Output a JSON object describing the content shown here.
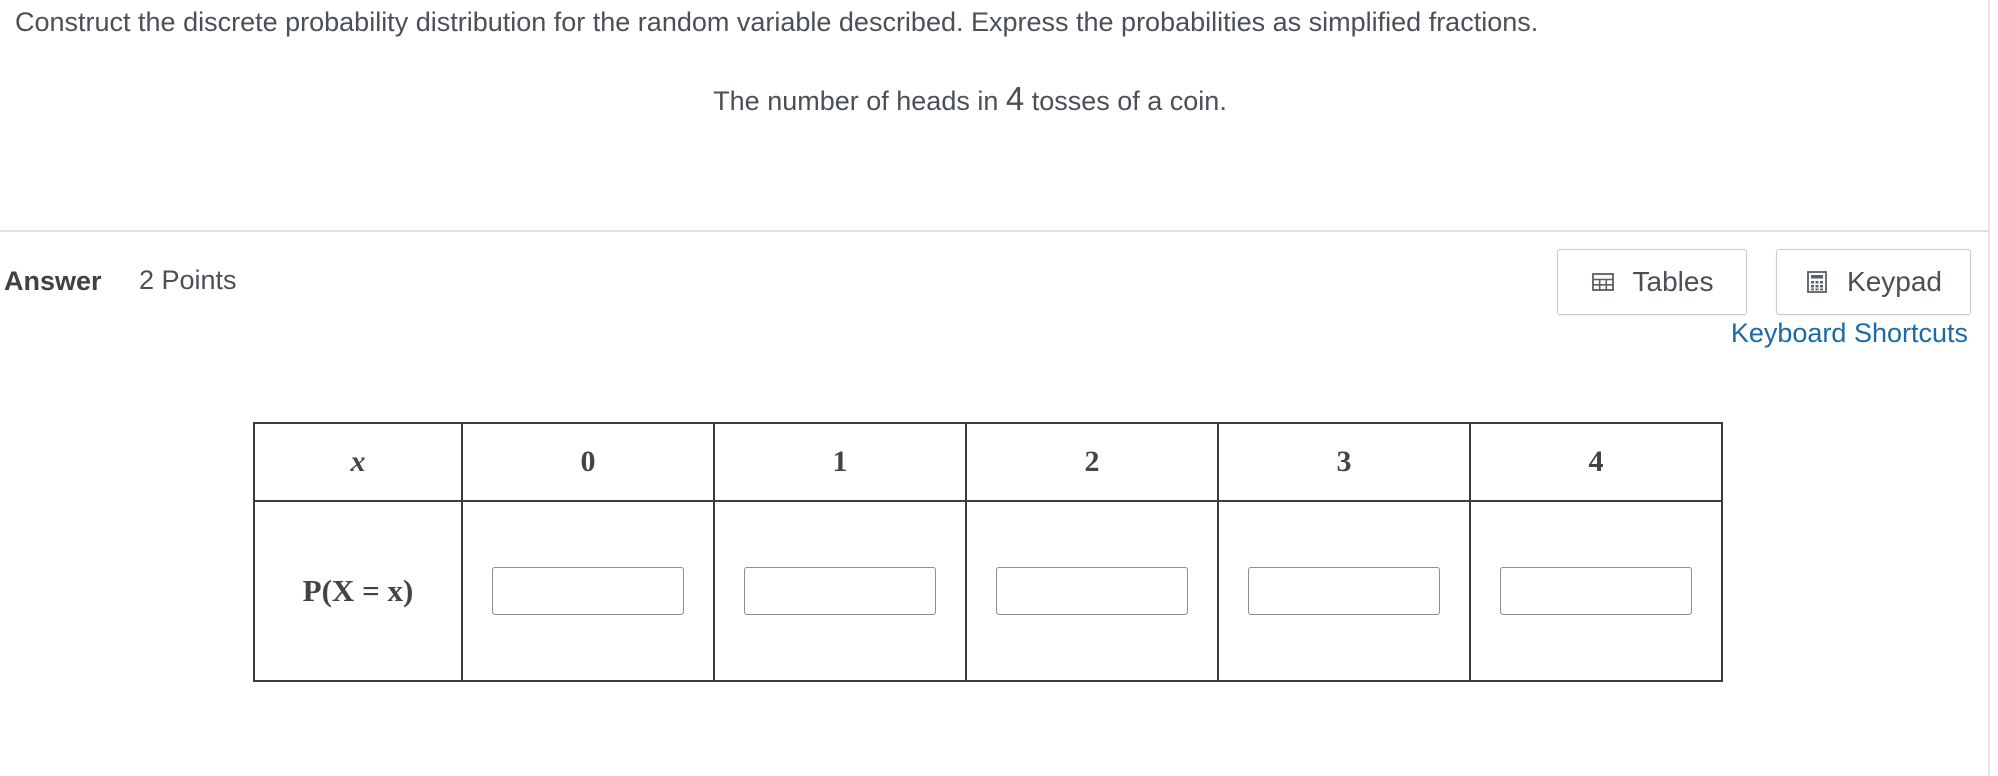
{
  "question": {
    "prompt": "Construct the discrete probability distribution for the random variable described. Express the probabilities as simplified fractions.",
    "subprompt_before": "The number of heads in ",
    "subprompt_number": "4",
    "subprompt_after": " tosses of a coin."
  },
  "answer": {
    "label": "Answer",
    "points": "2 Points"
  },
  "toolbar": {
    "tables_label": "Tables",
    "keypad_label": "Keypad",
    "shortcuts_label": "Keyboard Shortcuts",
    "tables_icon": "table-grid-icon",
    "keypad_icon": "calculator-icon"
  },
  "table": {
    "row_header": "x",
    "prob_label": "P(X = x)",
    "columns": [
      "0",
      "1",
      "2",
      "3",
      "4"
    ],
    "inputs": [
      "",
      "",
      "",
      "",
      ""
    ]
  },
  "colors": {
    "link": "#1b6aa8",
    "text": "#4a5055",
    "border": "#3c3c3c"
  }
}
